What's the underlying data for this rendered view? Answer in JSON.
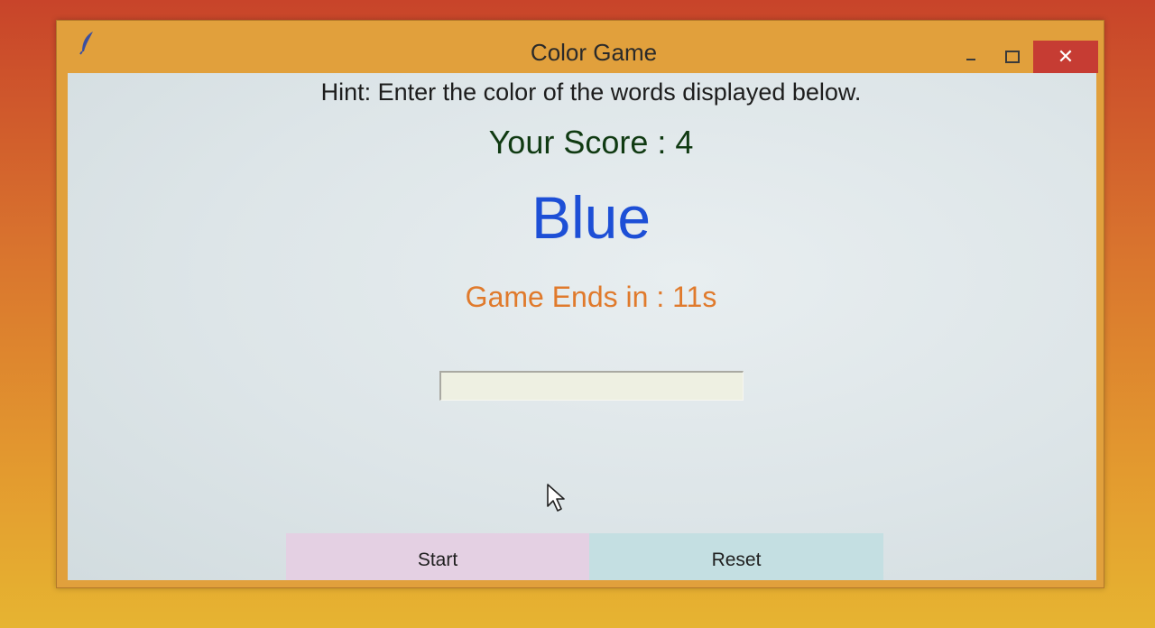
{
  "window": {
    "title": "Color Game",
    "icon": "feather-icon",
    "controls": {
      "minimize_icon": "minimize-icon",
      "maximize_icon": "maximize-icon",
      "close_label": "✕"
    }
  },
  "game": {
    "hint": "Hint: Enter the color of the words displayed below.",
    "score": "Your Score : 4",
    "word": "Blue",
    "word_color": "#1d4fd6",
    "timer": "Game Ends in : 11s",
    "timer_color": "#e07a2c",
    "entry_value": ""
  },
  "buttons": {
    "start_label": "Start",
    "reset_label": "Reset",
    "start_color": "#e4d0e3",
    "reset_color": "#c4dfe2"
  }
}
